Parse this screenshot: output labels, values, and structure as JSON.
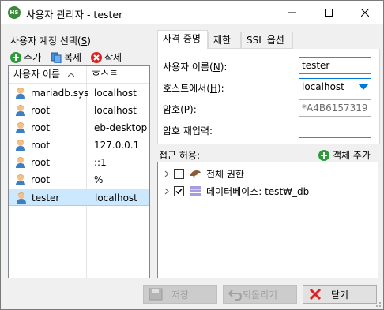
{
  "window": {
    "title": "사용자 관리자 - tester"
  },
  "users": {
    "section_label": "사용자 계정 선택",
    "section_hotkey": "S",
    "add_label": "추가",
    "clone_label": "복제",
    "delete_label": "삭제",
    "col_user": "사용자 이름",
    "col_host": "호스트",
    "rows": [
      {
        "user": "mariadb.sys",
        "host": "localhost"
      },
      {
        "user": "root",
        "host": "localhost"
      },
      {
        "user": "root",
        "host": "eb-desktop"
      },
      {
        "user": "root",
        "host": "127.0.0.1"
      },
      {
        "user": "root",
        "host": "::1"
      },
      {
        "user": "root",
        "host": "%"
      },
      {
        "user": "tester",
        "host": "localhost"
      }
    ],
    "selected_index": 6
  },
  "tabs": [
    {
      "label": "자격 증명"
    },
    {
      "label": "제한"
    },
    {
      "label": "SSL 옵션"
    }
  ],
  "credentials": {
    "username_label": "사용자 이름",
    "username_hotkey": "N",
    "username_value": "tester",
    "host_label": "호스트에서",
    "host_hotkey": "H",
    "host_value": "localhost",
    "password_label": "암호",
    "password_hotkey": "P",
    "password_value": "*A4B6157319",
    "repeat_label": "암호 재입력:",
    "repeat_value": ""
  },
  "access": {
    "label": "접근 허용:",
    "add_object_label": "객체 추가",
    "items": [
      {
        "label": "전체 권한",
        "checked": false
      },
      {
        "label": "데이터베이스: test₩_db",
        "checked": true
      }
    ]
  },
  "buttons": {
    "save": "저장",
    "revert": "되돌리기",
    "close": "닫기"
  },
  "colors": {
    "selection": "#cce8ff",
    "accent_blue": "#0078d7",
    "add_green": "#2e9b3a",
    "delete_red": "#e02020"
  }
}
